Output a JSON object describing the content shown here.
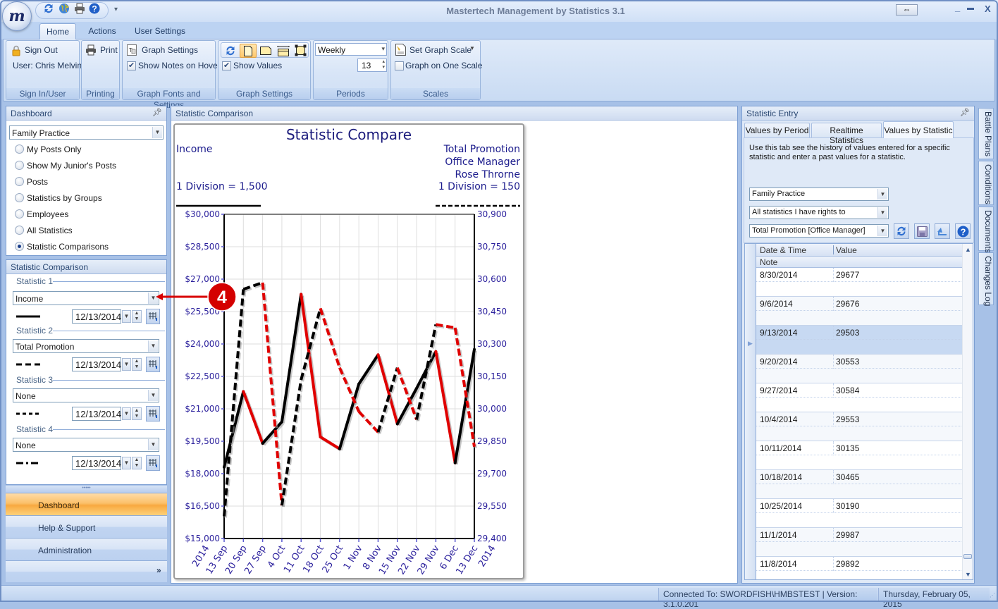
{
  "window": {
    "title": "Mastertech Management by Statistics 3.1",
    "logo_letter": "m",
    "controls": {
      "restore": "⇔",
      "minimize": "_",
      "maximize": "▬",
      "close": "X"
    }
  },
  "quick_access": {
    "customize": "▾"
  },
  "ribbon": {
    "tabs": [
      {
        "label": "Home",
        "active": true
      },
      {
        "label": "Actions",
        "active": false
      },
      {
        "label": "User Settings",
        "active": false
      }
    ],
    "sign_in": {
      "group_label": "Sign In/User",
      "sign_out": "Sign Out",
      "user": "User: Chris Melvin"
    },
    "printing": {
      "group_label": "Printing",
      "print": "Print"
    },
    "graph_fonts": {
      "group_label": "Graph Fonts and Settings",
      "graph_settings": "Graph Settings",
      "show_notes": "Show Notes on Hover",
      "show_notes_checked": true
    },
    "graph_settings": {
      "group_label": "Graph Settings",
      "show_values": "Show Values",
      "show_values_checked": true,
      "selected_layout": "portrait"
    },
    "periods": {
      "group_label": "Periods",
      "period": "Weekly",
      "count": "13"
    },
    "scales": {
      "group_label": "Scales",
      "set_scale": "Set Graph Scale",
      "one_scale": "Graph on One Scale",
      "one_scale_checked": false
    }
  },
  "dashboard": {
    "header": "Dashboard",
    "org": "Family Practice",
    "options": [
      {
        "label": "My Posts Only",
        "selected": false
      },
      {
        "label": "Show My Junior's Posts",
        "selected": false
      },
      {
        "label": "Posts",
        "selected": false
      },
      {
        "label": "Statistics by Groups",
        "selected": false
      },
      {
        "label": "Employees",
        "selected": false
      },
      {
        "label": "All Statistics",
        "selected": false
      },
      {
        "label": "Statistic Comparisons",
        "selected": true
      }
    ]
  },
  "comparison": {
    "header": "Statistic Comparison",
    "statistics": [
      {
        "label": "Statistic 1",
        "value": "Income",
        "line_style": "solid",
        "date": "12/13/2014"
      },
      {
        "label": "Statistic 2",
        "value": "Total Promotion",
        "line_style": "dashed",
        "date": "12/13/2014"
      },
      {
        "label": "Statistic 3",
        "value": "None",
        "line_style": "dotted",
        "date": "12/13/2014"
      },
      {
        "label": "Statistic 4",
        "value": "None",
        "line_style": "dash-dot",
        "date": "12/13/2014"
      }
    ]
  },
  "nav": {
    "items": [
      {
        "label": "Dashboard",
        "active": true
      },
      {
        "label": "Help & Support",
        "active": false
      },
      {
        "label": "Administration",
        "active": false
      }
    ],
    "overflow": "»"
  },
  "center": {
    "header": "Statistic Comparison"
  },
  "chart_data": {
    "type": "line",
    "title": "Statistic Compare",
    "left_label": {
      "name": "Income",
      "division": "1 Division = 1,500"
    },
    "right_label": {
      "lines": [
        "Total Promotion",
        "Office Manager",
        "Rose Throrne"
      ],
      "division": "1 Division = 150"
    },
    "categories": [
      "13 Sep",
      "20 Sep",
      "27 Sep",
      "4 Oct",
      "11 Oct",
      "18 Oct",
      "25 Oct",
      "1 Nov",
      "8 Nov",
      "15 Nov",
      "22 Nov",
      "29 Nov",
      "6 Dec",
      "13 Dec"
    ],
    "x_year_labels": {
      "first": "2014",
      "last": "2014"
    },
    "y_left": {
      "min": 15000,
      "max": 30000,
      "step": 1500,
      "tick_labels": [
        "$30,000",
        "$28,500",
        "$27,000",
        "$25,500",
        "$24,000",
        "$22,500",
        "$21,000",
        "$19,500",
        "$18,000",
        "$16,500",
        "$15,000"
      ]
    },
    "y_right": {
      "min": 29400,
      "max": 30900,
      "step": 150,
      "tick_labels": [
        "30,900",
        "30,750",
        "30,600",
        "30,450",
        "30,300",
        "30,150",
        "30,000",
        "29,850",
        "29,700",
        "29,550",
        "29,400"
      ]
    },
    "series": [
      {
        "name": "Income",
        "axis": "left",
        "line_style": "solid",
        "values": [
          18300,
          21800,
          19400,
          20400,
          26300,
          19700,
          19150,
          22150,
          23500,
          20300,
          21950,
          23650,
          18500,
          23750
        ]
      },
      {
        "name": "Total Promotion",
        "axis": "right",
        "line_style": "dashed",
        "values": [
          29503,
          30553,
          30584,
          29553,
          30135,
          30465,
          30190,
          29987,
          29892,
          30190,
          29950,
          30390,
          30375,
          29825
        ]
      }
    ],
    "up_color": "#000000",
    "down_color": "#e00000",
    "grid": true,
    "legend": "top"
  },
  "statistic_entry": {
    "header": "Statistic Entry",
    "tabs": [
      {
        "label": "Values by Period",
        "active": false
      },
      {
        "label": "Realtime Statistics",
        "active": false
      },
      {
        "label": "Values by Statistic",
        "active": true
      }
    ],
    "description": "Use this tab see the history of values entered for a specific statistic and enter a past values for a statistic.",
    "org": "Family Practice",
    "filter": "All statistics I have rights to",
    "statistic": "Total Promotion [Office Manager]",
    "columns": {
      "date": "Date & Time",
      "value": "Value",
      "note": "Note"
    },
    "rows": [
      {
        "date": "8/30/2014",
        "value": "29677",
        "selected": false
      },
      {
        "date": "9/6/2014",
        "value": "29676",
        "selected": false
      },
      {
        "date": "9/13/2014",
        "value": "29503",
        "selected": true
      },
      {
        "date": "9/20/2014",
        "value": "30553",
        "selected": false
      },
      {
        "date": "9/27/2014",
        "value": "30584",
        "selected": false
      },
      {
        "date": "10/4/2014",
        "value": "29553",
        "selected": false
      },
      {
        "date": "10/11/2014",
        "value": "30135",
        "selected": false
      },
      {
        "date": "10/18/2014",
        "value": "30465",
        "selected": false
      },
      {
        "date": "10/25/2014",
        "value": "30190",
        "selected": false
      },
      {
        "date": "11/1/2014",
        "value": "29987",
        "selected": false
      },
      {
        "date": "11/8/2014",
        "value": "29892",
        "selected": false
      }
    ]
  },
  "side_tabs": [
    "Battle Plans",
    "Conditions",
    "Documents",
    "Changes Log"
  ],
  "status": {
    "connection": "Connected To: SWORDFISH\\HMBSTEST | Version: 3.1.0.201",
    "date": "Thursday, February 05, 2015"
  },
  "annotation": {
    "number": "4"
  }
}
